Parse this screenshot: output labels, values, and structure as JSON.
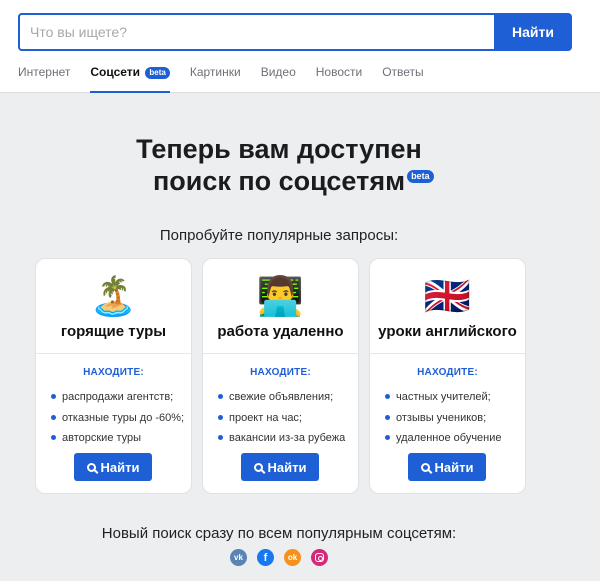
{
  "search": {
    "placeholder": "Что вы ищете?",
    "button_label": "Найти"
  },
  "tabs": [
    {
      "label": "Интернет",
      "active": false
    },
    {
      "label": "Соцсети",
      "active": true,
      "badge": "beta"
    },
    {
      "label": "Картинки",
      "active": false
    },
    {
      "label": "Видео",
      "active": false
    },
    {
      "label": "Новости",
      "active": false
    },
    {
      "label": "Ответы",
      "active": false
    }
  ],
  "hero": {
    "line1": "Теперь вам доступен",
    "line2": "поиск по соцсетям",
    "badge": "beta"
  },
  "subtitle": "Попробуйте популярные запросы:",
  "cards": [
    {
      "emoji": "🏝️",
      "icon": "island-icon",
      "title": "горящие туры",
      "find_label": "НАХОДИТЕ:",
      "items": [
        "распродажи агентств;",
        "отказные туры до -60%;",
        "авторские туры"
      ],
      "button_label": "Найти"
    },
    {
      "emoji": "👨‍💻",
      "icon": "technologist-icon",
      "title": "работа удаленно",
      "find_label": "НАХОДИТЕ:",
      "items": [
        "свежие объявления;",
        "проект на час;",
        "вакансии из-за рубежа"
      ],
      "button_label": "Найти"
    },
    {
      "emoji": "🇬🇧",
      "icon": "uk-flag-icon",
      "title": "уроки английского",
      "find_label": "НАХОДИТЕ:",
      "items": [
        "частных учителей;",
        "отзывы учеников;",
        "удаленное обучение"
      ],
      "button_label": "Найти"
    }
  ],
  "bottom_text": "Новый поиск сразу по всем популярным соцсетям:",
  "socials": [
    {
      "name": "vk",
      "glyph": "vk",
      "color": "#5c84b2"
    },
    {
      "name": "facebook",
      "glyph": "f",
      "color": "#1877f2"
    },
    {
      "name": "odnoklassniki",
      "glyph": "ok",
      "color": "#f5921e"
    },
    {
      "name": "instagram",
      "glyph": "",
      "color": "#d6287a"
    }
  ],
  "colors": {
    "accent": "#1f5fd6",
    "background": "#edeef0"
  }
}
